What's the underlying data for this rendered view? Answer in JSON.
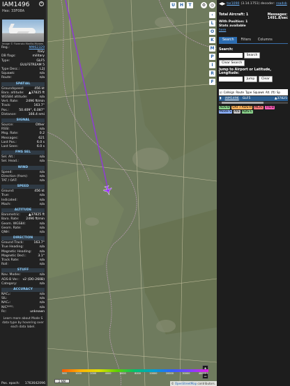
{
  "infoblock": {
    "callsign": "IAM1496",
    "hex_label": "Hex:",
    "hex": "33F08A",
    "photo_credit": "Image © Florenzio Marilla-Moraes",
    "reg_rows": [
      {
        "k": "Reg.:",
        "v": "MM62329",
        "link": true
      },
      {
        "k": "",
        "v": "Italy"
      },
      {
        "k": "DB flags:",
        "v": "military"
      },
      {
        "k": "Type:",
        "v": "GLF5"
      },
      {
        "k": "",
        "v": "GULFSTREAM 5"
      },
      {
        "k": "Type Desc.:",
        "v": "L2J"
      },
      {
        "k": "Squawk:",
        "v": "n/a"
      },
      {
        "k": "Route:",
        "v": "n/a"
      }
    ],
    "sections": [
      {
        "title": "SPATIAL",
        "rows": [
          {
            "k": "Groundspeed:",
            "v": "456 kt"
          },
          {
            "k": "Baro. altitude:",
            "v": "▲37825 ft"
          },
          {
            "k": "WGS84 altitude:",
            "v": "n/a"
          },
          {
            "k": "Vert. Rate:",
            "v": "2496 ft/min"
          },
          {
            "k": "Track:",
            "v": "163.7°"
          },
          {
            "k": "Pos.:",
            "v": "50.409°, 6.087°"
          },
          {
            "k": "Distance:",
            "v": "166.4 nmi"
          }
        ]
      },
      {
        "title": "SIGNAL",
        "rows": [
          {
            "k": "Source:",
            "v": "Other"
          },
          {
            "k": "RSSI:",
            "v": "n/a"
          },
          {
            "k": "Msg. Rate:",
            "v": "0.2"
          },
          {
            "k": "Messages:",
            "v": "621"
          },
          {
            "k": "Last Pos.:",
            "v": "6.0 s"
          },
          {
            "k": "Last Seen:",
            "v": "6.0 s"
          }
        ]
      },
      {
        "title": "FMS SEL",
        "rows": [
          {
            "k": "Sel. Alt.:",
            "v": "n/a"
          },
          {
            "k": "Sel. Head.:",
            "v": "n/a"
          }
        ]
      },
      {
        "title": "WIND",
        "rows": [
          {
            "k": "Speed:",
            "v": "n/a"
          },
          {
            "k": "Direction (from):",
            "v": "n/a"
          },
          {
            "k": "TAT / OAT:",
            "v": "n/a"
          }
        ]
      },
      {
        "title": "SPEED",
        "rows": [
          {
            "k": "Ground:",
            "v": "456 kt"
          },
          {
            "k": "True:",
            "v": "n/a"
          },
          {
            "k": "Indicated:",
            "v": "n/a"
          },
          {
            "k": "Mach:",
            "v": "n/a"
          }
        ]
      },
      {
        "title": "ALTITUDE",
        "rows": [
          {
            "k": "Barometric:",
            "v": "▲37825 ft"
          },
          {
            "k": "Baro. Rate:",
            "v": "2496 ft/min"
          },
          {
            "k": "Geom. WGS84:",
            "v": "n/a"
          },
          {
            "k": "Geom. Rate:",
            "v": "n/a"
          },
          {
            "k": "QNH:",
            "v": "n/a"
          }
        ]
      },
      {
        "title": "DIRECTION",
        "rows": [
          {
            "k": "Ground Track:",
            "v": "163.7°"
          },
          {
            "k": "True Heading:",
            "v": "n/a"
          },
          {
            "k": "Magnetic Heading:",
            "v": "n/a"
          },
          {
            "k": "Magnetic Decl.:",
            "v": "3.1°"
          },
          {
            "k": "Track Rate:",
            "v": "n/a"
          },
          {
            "k": "Roll:",
            "v": "n/a"
          }
        ]
      },
      {
        "title": "STUFF",
        "rows": [
          {
            "k": "Nav. Modes:",
            "v": "n/a"
          },
          {
            "k": "ADS-B Ver.:",
            "v": "v2 (DO-260B)"
          },
          {
            "k": "Category:",
            "v": "n/a"
          }
        ]
      },
      {
        "title": "ACCURACY",
        "rows": [
          {
            "k": "NACₚ:",
            "v": "n/a"
          },
          {
            "k": "SIL:",
            "v": "n/a"
          },
          {
            "k": "NACᵥ:",
            "v": "n/a"
          },
          {
            "k": "NICᴮᴬᴿᴼ:",
            "v": "n/a"
          },
          {
            "k": "Rc:",
            "v": "unknown"
          }
        ]
      }
    ],
    "footer_note": "Learn more about Mode S data type by hovering over each data label.",
    "pos_epoch_label": "Pos. epoch:",
    "pos_epoch": "1763642096"
  },
  "map": {
    "buttons_top": [
      "U",
      "H",
      "T"
    ],
    "buttons_side": [
      "L",
      "O",
      "K",
      "M",
      "P",
      "I",
      "R",
      "F"
    ],
    "colorbar_labels": [
      "500",
      "1000",
      "2000",
      "4000",
      "6000",
      "8000",
      "10000",
      "20000",
      "30000",
      "40000+"
    ],
    "scale_label": "2 NM",
    "zoom_in": "+",
    "zoom_out": "−",
    "attribution_prefix": "© ",
    "attribution_link": "OpenStreetMap",
    "attribution_suffix": " contributors."
  },
  "side": {
    "arrows": "◀▶",
    "version_link": "tar1090",
    "version": "(3.14.1751) decoder:",
    "readsb_link": "readsb",
    "total_label": "Total Aircraft: 1",
    "messages_label": "Messages:",
    "messages_value": "1491.8/sec",
    "with_position": "With Position: 1",
    "stats_label": "Stats available",
    "stats_link": "here",
    "tabs": [
      "Search",
      "Filters",
      "Columns"
    ],
    "search_label": "Search:",
    "search_button": "Search",
    "clear_search": "Clear Search",
    "jump_label": "Jump to Airport or Latitude, Longitude:",
    "jump_button": "Jump",
    "clear_button": "Clear",
    "table_headers": [
      "Callsign",
      "Route",
      "Type",
      "Squawk",
      "Alt. (ft)",
      "Sp"
    ],
    "table_row": {
      "callsign": "IAM1496",
      "type": "GLF5",
      "alt": "▲37825"
    },
    "badges": [
      {
        "label": "ADS-B",
        "color": "#8bd38b"
      },
      {
        "label": "UAT / ADS-R",
        "color": "#ffb35c"
      },
      {
        "label": "MLAT",
        "color": "#ff7b7b"
      },
      {
        "label": "TIS-B",
        "color": "#ff5cb8"
      },
      {
        "label": "Mode-S",
        "color": "#8fb4ff"
      },
      {
        "label": "AIS",
        "color": "#cccccc"
      },
      {
        "label": "ADS-C",
        "color": "#8bd38b"
      }
    ]
  }
}
